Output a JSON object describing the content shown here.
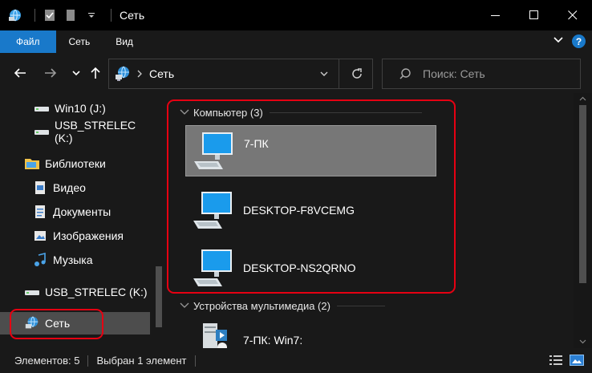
{
  "window": {
    "title": "Сеть",
    "minimize_icon": "minimize-icon",
    "maximize_icon": "maximize-icon",
    "close_icon": "close-icon"
  },
  "ribbon": {
    "tabs": [
      {
        "label": "Файл",
        "active": true
      },
      {
        "label": "Сеть"
      },
      {
        "label": "Вид"
      }
    ],
    "help_label": "?"
  },
  "address": {
    "path": "Сеть",
    "search_placeholder": "Поиск: Сеть"
  },
  "sidebar": {
    "items": [
      {
        "label": "Win10 (J:)",
        "icon": "drive-icon"
      },
      {
        "label": "USB_STRELEC (K:)",
        "icon": "drive-icon"
      },
      {
        "label": "Библиотеки",
        "icon": "libraries-icon"
      },
      {
        "label": "Видео",
        "icon": "video-icon"
      },
      {
        "label": "Документы",
        "icon": "documents-icon"
      },
      {
        "label": "Изображения",
        "icon": "pictures-icon"
      },
      {
        "label": "Музыка",
        "icon": "music-icon"
      },
      {
        "label": "USB_STRELEC (K:)",
        "icon": "drive-icon"
      },
      {
        "label": "Сеть",
        "icon": "network-icon",
        "selected": true
      }
    ]
  },
  "content": {
    "groups": [
      {
        "title": "Компьютер (3)",
        "items": [
          {
            "label": "7-ПК",
            "selected": true
          },
          {
            "label": "DESKTOP-F8VCEMG"
          },
          {
            "label": "DESKTOP-NS2QRNO"
          }
        ]
      },
      {
        "title": "Устройства мультимедиа (2)",
        "items": [
          {
            "label": "7-ПК: Win7:"
          }
        ]
      }
    ]
  },
  "status": {
    "items_count": "Элементов: 5",
    "selected": "Выбран 1 элемент"
  },
  "colors": {
    "accent": "#1979ca",
    "highlight": "#e60012",
    "background": "#191919"
  }
}
